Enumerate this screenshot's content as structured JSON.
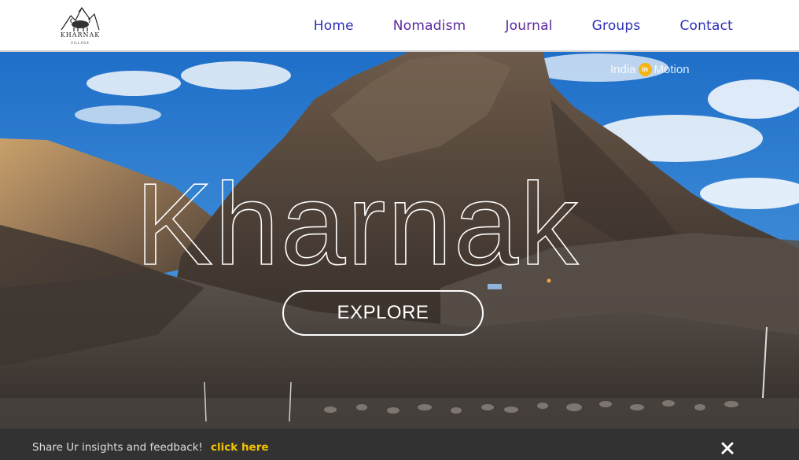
{
  "header": {
    "logo_text": "KHARNAK",
    "logo_subtext": "VILLAGE",
    "nav": [
      {
        "label": "Home"
      },
      {
        "label": "Nomadism"
      },
      {
        "label": "Journal"
      },
      {
        "label": "Groups"
      },
      {
        "label": "Contact"
      }
    ]
  },
  "hero": {
    "title": "Kharnak",
    "explore_label": "EXPLORE",
    "watermark_left": "India",
    "watermark_badge": "in",
    "watermark_right": "Motion"
  },
  "feedback": {
    "text": "Share Ur insights and feedback!",
    "link_label": "click here"
  },
  "colors": {
    "nav_blue": "#2c2fb8",
    "nav_purple": "#5b2a9c",
    "link_yellow": "#f2c200",
    "badge_yellow": "#f2b515"
  },
  "icons": {
    "logo": "yak-mountain-logo",
    "close": "close-icon"
  }
}
